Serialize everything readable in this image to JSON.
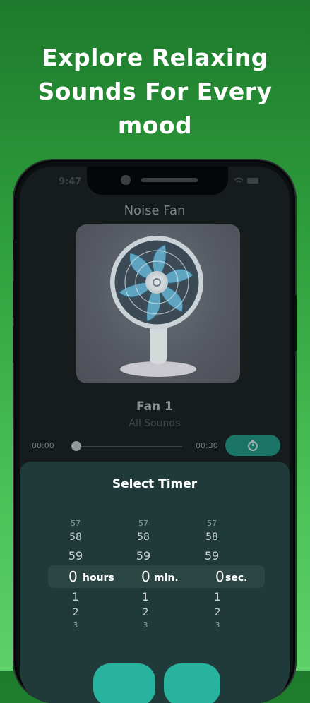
{
  "headline": "Explore Relaxing\nSounds For Every\nmood",
  "status": {
    "time": "9:47"
  },
  "player": {
    "nav_title": "Noise Fan",
    "track_title": "Fan 1",
    "track_subtitle": "All Sounds",
    "elapsed": "00:00",
    "duration": "00:30",
    "progress": 0.0
  },
  "timer_sheet": {
    "title": "Select Timer",
    "hours": {
      "above": [
        "57",
        "58",
        "59"
      ],
      "selected": "0",
      "unit": "hours",
      "below": [
        "1",
        "2",
        "3"
      ]
    },
    "minutes": {
      "above": [
        "57",
        "58",
        "59"
      ],
      "selected": "0",
      "unit": "min.",
      "below": [
        "1",
        "2",
        "3"
      ]
    },
    "seconds": {
      "above": [
        "57",
        "58",
        "59"
      ],
      "selected": "0",
      "unit": "sec.",
      "below": [
        "1",
        "2",
        "3"
      ]
    }
  },
  "colors": {
    "accent": "#1a7566",
    "sheet": "#1f3a39",
    "background_top": "#1d7a2c",
    "background_bottom": "#5fd06a"
  },
  "icons": {
    "timer": "stopwatch-icon"
  }
}
